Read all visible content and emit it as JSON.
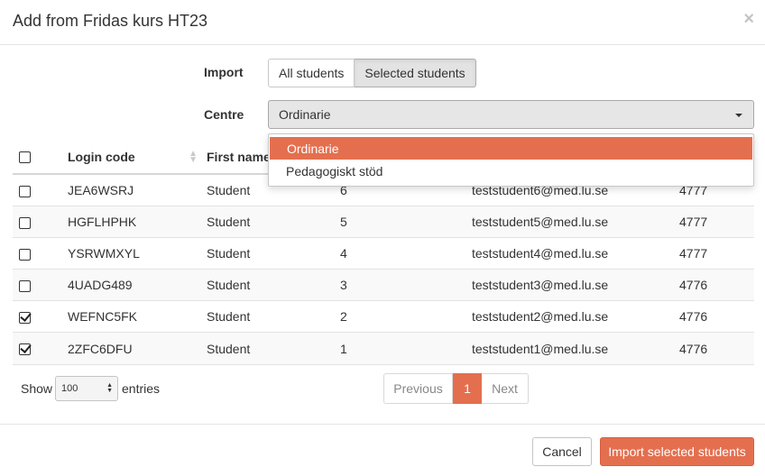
{
  "modal": {
    "title": "Add from Fridas kurs HT23",
    "close_symbol": "×"
  },
  "import": {
    "label": "Import",
    "options": [
      "All students",
      "Selected students"
    ],
    "selected": "Selected students"
  },
  "centre": {
    "label": "Centre",
    "value": "Ordinarie",
    "options": [
      {
        "label": "Ordinarie",
        "highlighted": true
      },
      {
        "label": "Pedagogiskt stöd",
        "highlighted": false
      }
    ]
  },
  "table": {
    "headers": {
      "login_code": "Login code",
      "first_name": "First name"
    },
    "rows": [
      {
        "checked": false,
        "login": "JEA6WSRJ",
        "first": "Student",
        "last": "6",
        "email": "teststudent6@med.lu.se",
        "code": "4777"
      },
      {
        "checked": false,
        "login": "HGFLHPHK",
        "first": "Student",
        "last": "5",
        "email": "teststudent5@med.lu.se",
        "code": "4777"
      },
      {
        "checked": false,
        "login": "YSRWMXYL",
        "first": "Student",
        "last": "4",
        "email": "teststudent4@med.lu.se",
        "code": "4777"
      },
      {
        "checked": false,
        "login": "4UADG489",
        "first": "Student",
        "last": "3",
        "email": "teststudent3@med.lu.se",
        "code": "4776"
      },
      {
        "checked": true,
        "login": "WEFNC5FK",
        "first": "Student",
        "last": "2",
        "email": "teststudent2@med.lu.se",
        "code": "4776"
      },
      {
        "checked": true,
        "login": "2ZFC6DFU",
        "first": "Student",
        "last": "1",
        "email": "teststudent1@med.lu.se",
        "code": "4776"
      }
    ]
  },
  "length_menu": {
    "show_label": "Show",
    "value": "100",
    "entries_label": "entries"
  },
  "pagination": {
    "previous": "Previous",
    "current": "1",
    "next": "Next"
  },
  "footer": {
    "cancel": "Cancel",
    "import": "Import selected students"
  },
  "colors": {
    "accent": "#e46f4f"
  }
}
